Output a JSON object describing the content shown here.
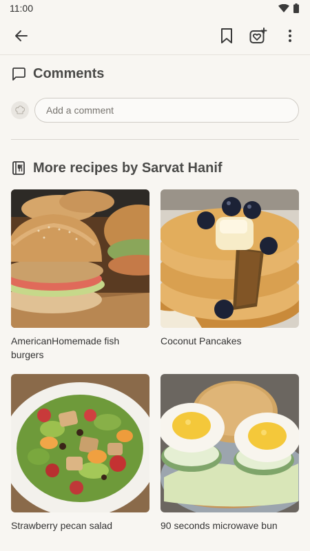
{
  "status": {
    "time": "11:00"
  },
  "toolbar": {
    "back_icon": "arrow-left-icon",
    "bookmark_icon": "bookmark-icon",
    "cooksnap_icon": "heart-plus-icon",
    "more_icon": "more-vertical-icon"
  },
  "comments": {
    "title": "Comments",
    "icon": "chat-bubble-icon",
    "input_placeholder": "Add a comment"
  },
  "more_recipes": {
    "title": "More recipes by Sarvat Hanif",
    "icon": "recipe-book-icon",
    "recipes": [
      {
        "title": "AmericanHomemade fish burgers"
      },
      {
        "title": "Coconut Pancakes"
      },
      {
        "title": "Strawberry pecan salad"
      },
      {
        "title": "90 seconds microwave bun"
      }
    ]
  },
  "colors": {
    "background": "#f8f6f2",
    "text": "#3a3a38",
    "divider": "#d9d5cf"
  }
}
